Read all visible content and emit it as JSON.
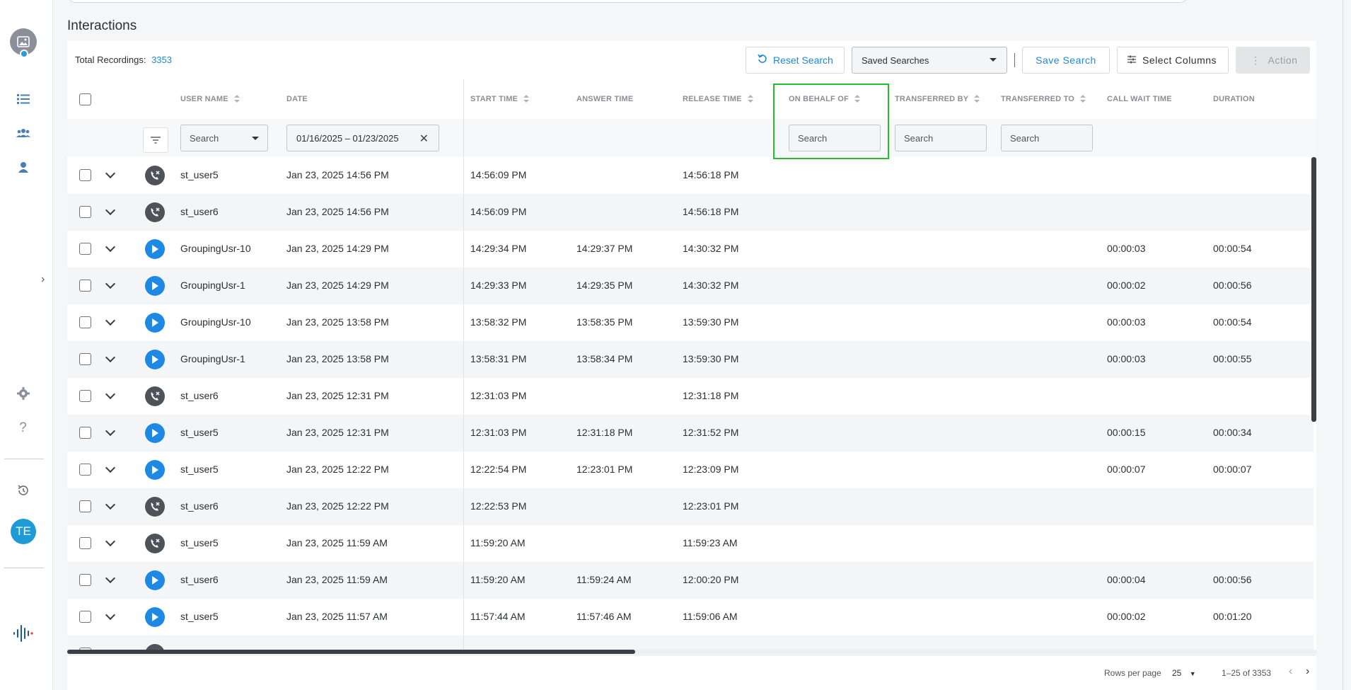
{
  "app": {
    "user_initials": "TE"
  },
  "page": {
    "title": "Interactions",
    "total_label": "Total Recordings:",
    "total_count": "3353"
  },
  "toolbar": {
    "reset_label": "Reset Search",
    "saved_searches_label": "Saved Searches",
    "save_label": "Save Search",
    "select_columns_label": "Select Columns",
    "action_label": "Action"
  },
  "columns": {
    "user_name": "USER NAME",
    "date": "DATE",
    "start_time": "START TIME",
    "answer_time": "ANSWER TIME",
    "release_time": "RELEASE TIME",
    "on_behalf_of": "ON BEHALF OF",
    "transferred_by": "TRANSFERRED BY",
    "transferred_to": "TRANSFERRED TO",
    "call_wait_time": "CALL WAIT TIME",
    "duration": "DURATION"
  },
  "filters": {
    "user_placeholder": "Search",
    "date_range": "01/16/2025 – 01/23/2025",
    "on_behalf_placeholder": "Search",
    "transferred_by_placeholder": "Search",
    "transferred_to_placeholder": "Search"
  },
  "rows": [
    {
      "icon": "missed-call-icon",
      "user": "st_user5",
      "date": "Jan 23, 2025 14:56 PM",
      "start": "14:56:09 PM",
      "answer": "",
      "release": "14:56:18 PM",
      "wait": "",
      "duration": ""
    },
    {
      "icon": "missed-call-icon",
      "user": "st_user6",
      "date": "Jan 23, 2025 14:56 PM",
      "start": "14:56:09 PM",
      "answer": "",
      "release": "14:56:18 PM",
      "wait": "",
      "duration": ""
    },
    {
      "icon": "play-icon",
      "user": "GroupingUsr-10",
      "date": "Jan 23, 2025 14:29 PM",
      "start": "14:29:34 PM",
      "answer": "14:29:37 PM",
      "release": "14:30:32 PM",
      "wait": "00:00:03",
      "duration": "00:00:54"
    },
    {
      "icon": "play-icon",
      "user": "GroupingUsr-1",
      "date": "Jan 23, 2025 14:29 PM",
      "start": "14:29:33 PM",
      "answer": "14:29:35 PM",
      "release": "14:30:32 PM",
      "wait": "00:00:02",
      "duration": "00:00:56"
    },
    {
      "icon": "play-icon",
      "user": "GroupingUsr-10",
      "date": "Jan 23, 2025 13:58 PM",
      "start": "13:58:32 PM",
      "answer": "13:58:35 PM",
      "release": "13:59:30 PM",
      "wait": "00:00:03",
      "duration": "00:00:54"
    },
    {
      "icon": "play-icon",
      "user": "GroupingUsr-1",
      "date": "Jan 23, 2025 13:58 PM",
      "start": "13:58:31 PM",
      "answer": "13:58:34 PM",
      "release": "13:59:30 PM",
      "wait": "00:00:03",
      "duration": "00:00:55"
    },
    {
      "icon": "missed-call-icon",
      "user": "st_user6",
      "date": "Jan 23, 2025 12:31 PM",
      "start": "12:31:03 PM",
      "answer": "",
      "release": "12:31:18 PM",
      "wait": "",
      "duration": ""
    },
    {
      "icon": "play-icon",
      "user": "st_user5",
      "date": "Jan 23, 2025 12:31 PM",
      "start": "12:31:03 PM",
      "answer": "12:31:18 PM",
      "release": "12:31:52 PM",
      "wait": "00:00:15",
      "duration": "00:00:34"
    },
    {
      "icon": "play-icon",
      "user": "st_user5",
      "date": "Jan 23, 2025 12:22 PM",
      "start": "12:22:54 PM",
      "answer": "12:23:01 PM",
      "release": "12:23:09 PM",
      "wait": "00:00:07",
      "duration": "00:00:07"
    },
    {
      "icon": "missed-call-icon",
      "user": "st_user6",
      "date": "Jan 23, 2025 12:22 PM",
      "start": "12:22:53 PM",
      "answer": "",
      "release": "12:23:01 PM",
      "wait": "",
      "duration": ""
    },
    {
      "icon": "missed-call-icon",
      "user": "st_user5",
      "date": "Jan 23, 2025 11:59 AM",
      "start": "11:59:20 AM",
      "answer": "",
      "release": "11:59:23 AM",
      "wait": "",
      "duration": ""
    },
    {
      "icon": "play-icon",
      "user": "st_user6",
      "date": "Jan 23, 2025 11:59 AM",
      "start": "11:59:20 AM",
      "answer": "11:59:24 AM",
      "release": "12:00:20 PM",
      "wait": "00:00:04",
      "duration": "00:00:56"
    },
    {
      "icon": "play-icon",
      "user": "st_user5",
      "date": "Jan 23, 2025 11:57 AM",
      "start": "11:57:44 AM",
      "answer": "11:57:46 AM",
      "release": "11:59:06 AM",
      "wait": "00:00:02",
      "duration": "00:01:20"
    },
    {
      "icon": "missed-call-icon",
      "user": "",
      "date": "",
      "start": "",
      "answer": "",
      "release": "",
      "wait": "",
      "duration": ""
    }
  ],
  "pagination": {
    "rows_per_page_label": "Rows per page",
    "rows_per_page_value": "25",
    "range_label": "1–25 of 3353"
  },
  "colors": {
    "accent": "#1e88d6",
    "play": "#1e88e5",
    "missed": "#4e535a",
    "highlight": "#22c02a"
  }
}
